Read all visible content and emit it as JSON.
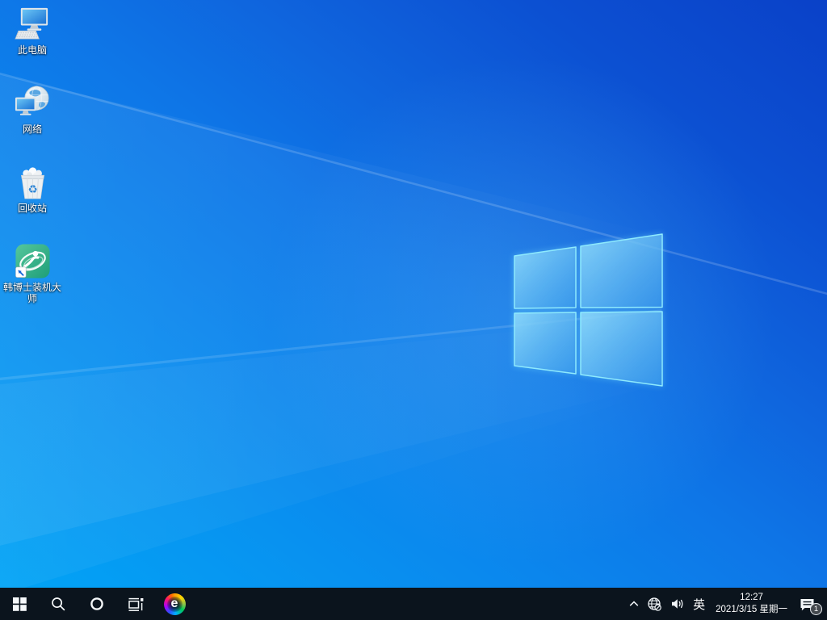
{
  "desktop": {
    "icons": [
      {
        "id": "this-pc",
        "label": "此电脑"
      },
      {
        "id": "network",
        "label": "网络"
      },
      {
        "id": "recycle-bin",
        "label": "回收站"
      },
      {
        "id": "hanboshi-installer",
        "label": "韩博士装机大师"
      }
    ],
    "recycle_glyph": "♻"
  },
  "taskbar": {
    "buttons": [
      {
        "id": "start",
        "icon": "windows-start-icon"
      },
      {
        "id": "search",
        "icon": "search-icon"
      },
      {
        "id": "cortana",
        "icon": "cortana-icon"
      },
      {
        "id": "task-view",
        "icon": "task-view-icon"
      },
      {
        "id": "edge",
        "icon": "edge-icon"
      }
    ],
    "edge_glyph": "e",
    "tray": {
      "hidden_icons_icon": "chevron-up-icon",
      "network_icon": "globe-no-internet-icon",
      "volume_icon": "speaker-icon",
      "input_indicator": "英",
      "clock": {
        "time": "12:27",
        "date": "2021/3/15 星期一"
      },
      "action_center": {
        "icon": "action-center-icon",
        "badge": "1"
      }
    }
  },
  "colors": {
    "wallpaper_bottom_left": "#01a6f6",
    "wallpaper_top_right": "#0a41c8",
    "logo_pane_fill": "#5bbbf2",
    "logo_pane_edge": "#8eeafd",
    "taskbar_background": "#0b141d",
    "hanboshi_green": "#2fa97d",
    "tray_glyph": "#f2f6f9",
    "shortcut_arrow_blue": "#1565d8",
    "recycle_symbol_blue": "#2f86d6"
  }
}
